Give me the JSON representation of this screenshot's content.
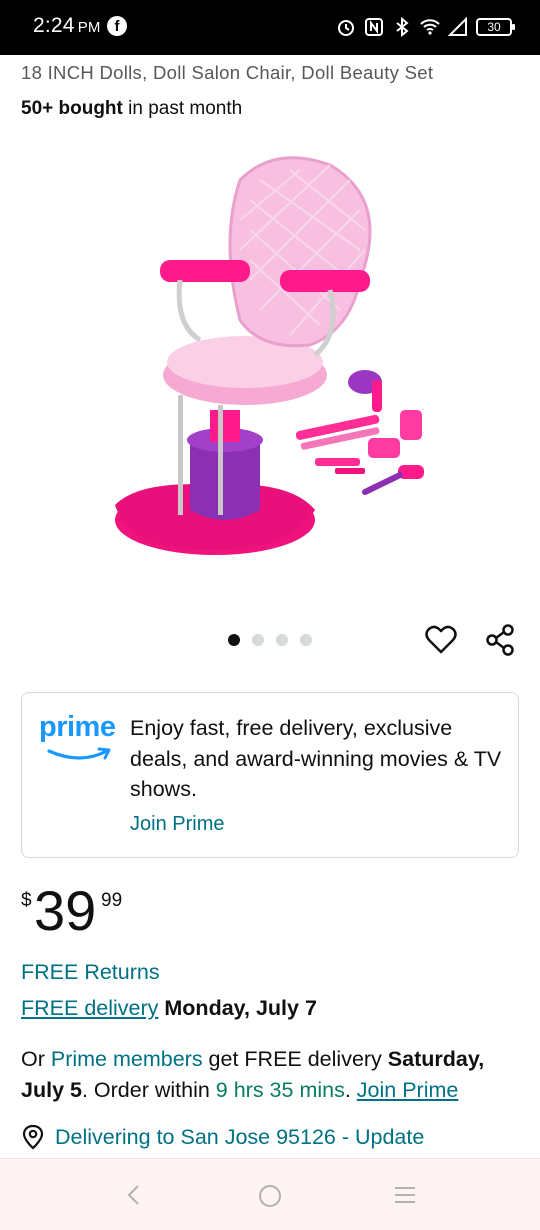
{
  "status_bar": {
    "time": "2:24",
    "ampm": "PM",
    "notification_icon": "facebook-icon",
    "battery": "30",
    "icons": [
      "alarm-icon",
      "nfc-icon",
      "bluetooth-icon",
      "wifi-icon",
      "signal-icon",
      "battery-icon"
    ]
  },
  "product": {
    "subtitle": "18 INCH Dolls, Doll Salon Chair, Doll Beauty Set",
    "bought_bold": "50+ bought",
    "bought_rest": " in past month",
    "image_alt": "pink-salon-chair-with-accessories",
    "carousel": {
      "count": 4,
      "active_index": 0
    }
  },
  "prime_card": {
    "logo": "prime",
    "text": "Enjoy fast, free delivery, exclusive deals, and award-winning movies & TV shows.",
    "join_label": "Join Prime"
  },
  "price": {
    "symbol": "$",
    "whole": "39",
    "fraction": "99"
  },
  "shipping": {
    "free_returns": "FREE Returns",
    "free_delivery_link": "FREE delivery",
    "free_delivery_date": "Monday, July 7"
  },
  "prime_offer": {
    "or": "Or ",
    "members_link": "Prime members",
    "mid": " get FREE delivery ",
    "date": "Saturday, July 5",
    "order_within": ". Order within ",
    "countdown": "9 hrs 35 mins",
    "dot": ". ",
    "join_link": "Join Prime"
  },
  "delivery_location": {
    "text": "Delivering to San Jose 95126 - Update"
  },
  "colors": {
    "link": "#007185",
    "prime_blue": "#1a98ff",
    "countdown_green": "#067d62",
    "text": "#0f1111",
    "muted": "#565959"
  }
}
